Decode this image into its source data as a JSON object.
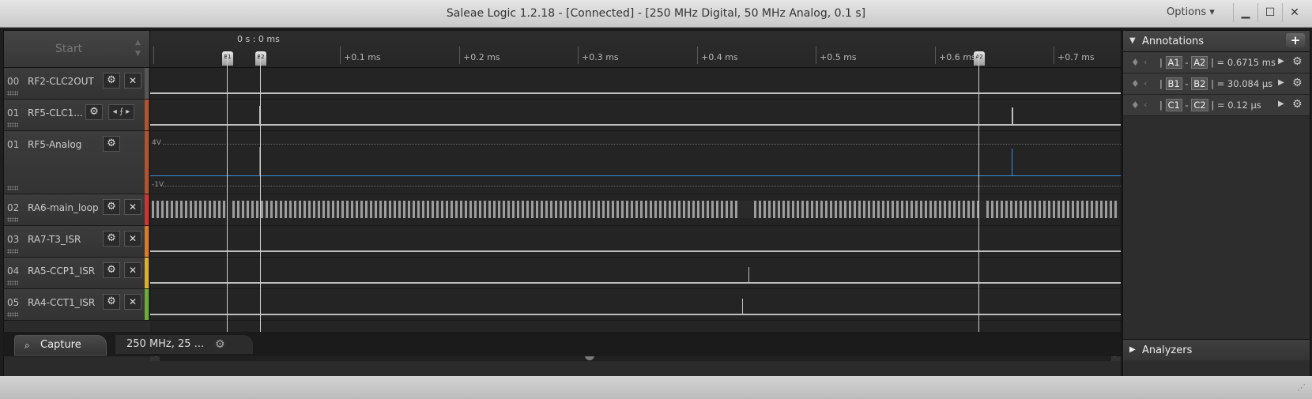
{
  "window": {
    "title": "Saleae Logic 1.2.18 - [Connected] - [250 MHz Digital, 50 MHz Analog, 0.1 s]",
    "options_label": "Options ▾",
    "minimize": "▁",
    "maximize": "☐",
    "close": "✕"
  },
  "start_button": "Start",
  "ruler": {
    "origin": "0 s : 0 ms",
    "ticks": [
      "+0.1 ms",
      "+0.2 ms",
      "+0.3 ms",
      "+0.4 ms",
      "+0.5 ms",
      "+0.6 ms",
      "+0.7 ms"
    ],
    "markers": [
      "B1",
      "B2",
      "A2"
    ]
  },
  "channels": [
    {
      "num": "00",
      "name": "RF2-CLC2OUT",
      "color": "#555555"
    },
    {
      "num": "01",
      "name": "RF5-CLC1...",
      "color": "#b8502a",
      "trigger": "◂ ⨍ ▸"
    },
    {
      "num": "01",
      "name": "RF5-Analog",
      "color": "#b8502a",
      "analog_max": "4V",
      "analog_min": "-1V"
    },
    {
      "num": "02",
      "name": "RA6-main_loop",
      "color": "#d8302a"
    },
    {
      "num": "03",
      "name": "RA7-T3_ISR",
      "color": "#e07a20"
    },
    {
      "num": "04",
      "name": "RA5-CCP1_ISR",
      "color": "#e0b020"
    },
    {
      "num": "05",
      "name": "RA4-CCT1_ISR",
      "color": "#6ab030"
    }
  ],
  "bottom": {
    "capture_label": "Capture",
    "session_label": "250 MHz, 25 ..."
  },
  "annotations": {
    "title": "Annotations",
    "add": "+",
    "rows": [
      {
        "a": "A1",
        "b": "A2",
        "value": "0.6715 ms"
      },
      {
        "a": "B1",
        "b": "B2",
        "value": "30.084 µs"
      },
      {
        "a": "C1",
        "b": "C2",
        "value": "0.12 µs"
      }
    ]
  },
  "analyzers": {
    "title": "Analyzers"
  }
}
